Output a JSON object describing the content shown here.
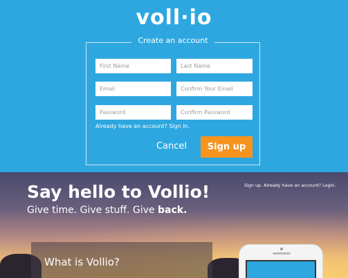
{
  "brand": {
    "logo_text": "voll·io"
  },
  "signup": {
    "heading": "Create an account",
    "fields": {
      "first_name": "First Name",
      "last_name": "Last Name",
      "email": "Email",
      "confirm_email": "Confirm Your Email",
      "password": "Password",
      "confirm_password": "Confirm Password"
    },
    "signin_link": "Already have an account? Sign in.",
    "cancel_label": "Cancel",
    "submit_label": "Sign up"
  },
  "hero": {
    "title": "Say hello to Vollio!",
    "subtitle_prefix": "Give time. Give stuff. Give ",
    "subtitle_bold": "back.",
    "top_link": "Sign up. Already have an account? Login.",
    "card_title": "What is Vollio?"
  },
  "colors": {
    "primary_blue": "#2ea7e0",
    "accent_orange": "#f7941d"
  }
}
